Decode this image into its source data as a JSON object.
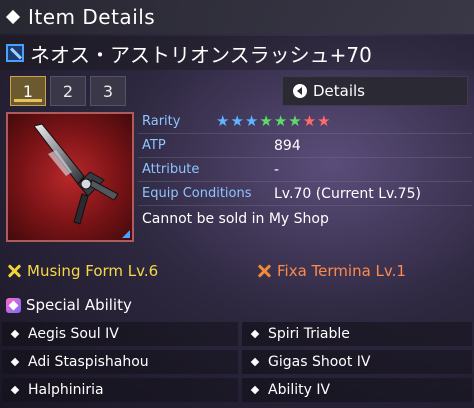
{
  "header": {
    "title": "Item Details"
  },
  "item": {
    "name": "ネオス・アストリオンスラッシュ+70",
    "type_icon": "sword-icon"
  },
  "tabs": [
    "1",
    "2",
    "3"
  ],
  "active_tab": 0,
  "details_button": {
    "label": "Details",
    "icon": "arrow-left-icon"
  },
  "stats": {
    "rarity_label": "Rarity",
    "rarity_stars": 8,
    "star_colors": [
      "#5fb4ff",
      "#5fb4ff",
      "#5fb4ff",
      "#5fd96a",
      "#5fd96a",
      "#5fd96a",
      "#ff6a6a",
      "#ff6a6a"
    ],
    "atp_label": "ATP",
    "atp_value": "894",
    "attribute_label": "Attribute",
    "attribute_value": "-",
    "equip_label": "Equip Conditions",
    "equip_value": "Lv.70 (Current Lv.75)",
    "note": "Cannot be sold in My Shop"
  },
  "forms": {
    "left": "Musing Form Lv.6",
    "right": "Fixa Termina Lv.1"
  },
  "special_ability": {
    "title": "Special Ability",
    "items": [
      [
        "Aegis Soul IV",
        "Spiri Triable"
      ],
      [
        "Adi Staspishahou",
        "Gigas Shoot IV"
      ],
      [
        "Halphiniria",
        "Ability IV"
      ]
    ]
  },
  "colors": {
    "accent_blue": "#8fc4ff",
    "form_yellow": "#f6d84a",
    "form_orange": "#ff8a4a",
    "frame_red": "#b05b5b"
  }
}
